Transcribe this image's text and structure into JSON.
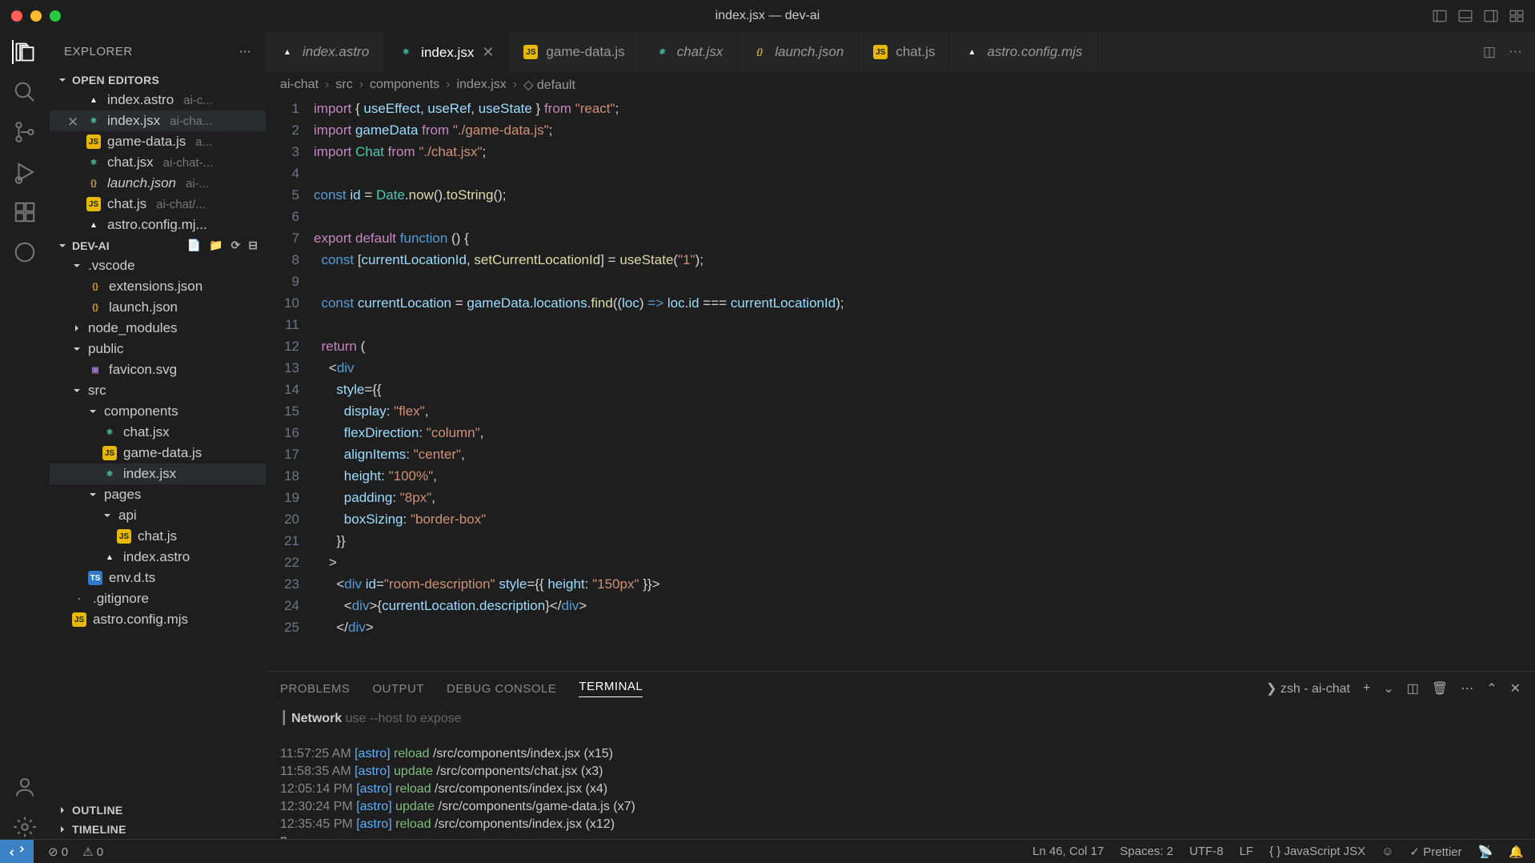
{
  "window": {
    "title": "index.jsx — dev-ai"
  },
  "explorer": {
    "title": "EXPLORER"
  },
  "openEditors": {
    "title": "OPEN EDITORS",
    "items": [
      {
        "icon": "astro",
        "name": "index.astro",
        "dim": "ai-c..."
      },
      {
        "icon": "react",
        "name": "index.jsx",
        "dim": "ai-cha...",
        "active": true
      },
      {
        "icon": "js",
        "name": "game-data.js",
        "dim": "a..."
      },
      {
        "icon": "react",
        "name": "chat.jsx",
        "dim": "ai-chat-..."
      },
      {
        "icon": "json",
        "name": "launch.json",
        "dim": "ai-...",
        "italic": true
      },
      {
        "icon": "js",
        "name": "chat.js",
        "dim": "ai-chat/..."
      },
      {
        "icon": "astro",
        "name": "astro.config.mj...",
        "dim": ""
      }
    ]
  },
  "project": {
    "name": "DEV-AI",
    "tree": [
      {
        "depth": 1,
        "type": "folder",
        "name": ".vscode",
        "open": true
      },
      {
        "depth": 2,
        "type": "file",
        "icon": "json",
        "name": "extensions.json"
      },
      {
        "depth": 2,
        "type": "file",
        "icon": "json",
        "name": "launch.json"
      },
      {
        "depth": 1,
        "type": "folder",
        "name": "node_modules",
        "open": false
      },
      {
        "depth": 1,
        "type": "folder",
        "name": "public",
        "open": true
      },
      {
        "depth": 2,
        "type": "file",
        "icon": "svg",
        "name": "favicon.svg"
      },
      {
        "depth": 1,
        "type": "folder",
        "name": "src",
        "open": true
      },
      {
        "depth": 2,
        "type": "folder",
        "name": "components",
        "open": true
      },
      {
        "depth": 3,
        "type": "file",
        "icon": "react",
        "name": "chat.jsx"
      },
      {
        "depth": 3,
        "type": "file",
        "icon": "js",
        "name": "game-data.js"
      },
      {
        "depth": 3,
        "type": "file",
        "icon": "react",
        "name": "index.jsx",
        "sel": true
      },
      {
        "depth": 2,
        "type": "folder",
        "name": "pages",
        "open": true
      },
      {
        "depth": 3,
        "type": "folder",
        "name": "api",
        "open": true
      },
      {
        "depth": 4,
        "type": "file",
        "icon": "js",
        "name": "chat.js"
      },
      {
        "depth": 3,
        "type": "file",
        "icon": "astro",
        "name": "index.astro"
      },
      {
        "depth": 2,
        "type": "file",
        "icon": "ts",
        "name": "env.d.ts"
      },
      {
        "depth": 1,
        "type": "file",
        "icon": "",
        "name": ".gitignore"
      },
      {
        "depth": 1,
        "type": "file",
        "icon": "js",
        "name": "astro.config.mjs"
      }
    ]
  },
  "outline": "OUTLINE",
  "timeline": "TIMELINE",
  "tabs": [
    {
      "icon": "astro",
      "label": "index.astro",
      "italic": true
    },
    {
      "icon": "react",
      "label": "index.jsx",
      "active": true,
      "close": true
    },
    {
      "icon": "js",
      "label": "game-data.js"
    },
    {
      "icon": "react",
      "label": "chat.jsx",
      "italic": true
    },
    {
      "icon": "json",
      "label": "launch.json",
      "italic": true
    },
    {
      "icon": "js",
      "label": "chat.js"
    },
    {
      "icon": "astro",
      "label": "astro.config.mjs",
      "italic": true
    }
  ],
  "breadcrumbs": [
    "ai-chat",
    "src",
    "components",
    "index.jsx",
    "default"
  ],
  "code": {
    "start": 1,
    "lines": [
      "<span class='k'>import</span> { <span class='v'>useEffect</span>, <span class='v'>useRef</span>, <span class='v'>useState</span> } <span class='k'>from</span> <span class='s'>\"react\"</span>;",
      "<span class='k'>import</span> <span class='v'>gameData</span> <span class='k'>from</span> <span class='s'>\"./game-data.js\"</span>;",
      "<span class='k'>import</span> <span class='t'>Chat</span> <span class='k'>from</span> <span class='s'>\"./chat.jsx\"</span>;",
      "",
      "<span class='c'>const</span> <span class='v'>id</span> = <span class='t'>Date</span>.<span class='f'>now</span>().<span class='f'>toString</span>();",
      "",
      "<span class='k'>export</span> <span class='k'>default</span> <span class='c'>function</span> () {",
      "  <span class='c'>const</span> [<span class='v'>currentLocationId</span>, <span class='f'>setCurrentLocationId</span>] = <span class='f'>useState</span>(<span class='s'>\"1\"</span>);",
      "",
      "  <span class='c'>const</span> <span class='v'>currentLocation</span> = <span class='v'>gameData</span>.<span class='v'>locations</span>.<span class='f'>find</span>((<span class='v'>loc</span>) <span class='c'>=&gt;</span> <span class='v'>loc</span>.<span class='v'>id</span> === <span class='v'>currentLocationId</span>);",
      "",
      "  <span class='k'>return</span> (",
      "    &lt;<span class='c'>div</span>",
      "      <span class='v'>style</span>={{",
      "        <span class='v'>display</span>: <span class='s'>\"flex\"</span>,",
      "        <span class='v'>flexDirection</span>: <span class='s'>\"column\"</span>,",
      "        <span class='v'>alignItems</span>: <span class='s'>\"center\"</span>,",
      "        <span class='v'>height</span>: <span class='s'>\"100%\"</span>,",
      "        <span class='v'>padding</span>: <span class='s'>\"8px\"</span>,",
      "        <span class='v'>boxSizing</span>: <span class='s'>\"border-box\"</span>",
      "      }}",
      "    &gt;",
      "      &lt;<span class='c'>div</span> <span class='v'>id</span>=<span class='s'>\"room-description\"</span> <span class='v'>style</span>={{ <span class='v'>height</span>: <span class='s'>\"150px\"</span> }}&gt;",
      "        &lt;<span class='c'>div</span>&gt;{<span class='v'>currentLocation</span>.<span class='v'>description</span>}&lt;/<span class='c'>div</span>&gt;",
      "      &lt;/<span class='c'>div</span>&gt;"
    ]
  },
  "panel": {
    "tabs": [
      "PROBLEMS",
      "OUTPUT",
      "DEBUG CONSOLE",
      "TERMINAL"
    ],
    "active": 3,
    "shell": "zsh - ai-chat",
    "network": "Network",
    "networkHint": "use --host to expose",
    "log": [
      {
        "time": "11:57:25 AM",
        "cmd": "reload",
        "path": "/src/components/index.jsx (x15)"
      },
      {
        "time": "11:58:35 AM",
        "cmd": "update",
        "path": "/src/components/chat.jsx (x3)"
      },
      {
        "time": "12:05:14 PM",
        "cmd": "reload",
        "path": "/src/components/index.jsx (x4)"
      },
      {
        "time": "12:30:24 PM",
        "cmd": "update",
        "path": "/src/components/game-data.js (x7)"
      },
      {
        "time": "12:35:45 PM",
        "cmd": "reload",
        "path": "/src/components/index.jsx (x12)"
      }
    ]
  },
  "status": {
    "errors": "0",
    "warnings": "0",
    "cursor": "Ln 46, Col 17",
    "spaces": "Spaces: 2",
    "encoding": "UTF-8",
    "eol": "LF",
    "lang": "JavaScript JSX",
    "prettier": "Prettier"
  }
}
